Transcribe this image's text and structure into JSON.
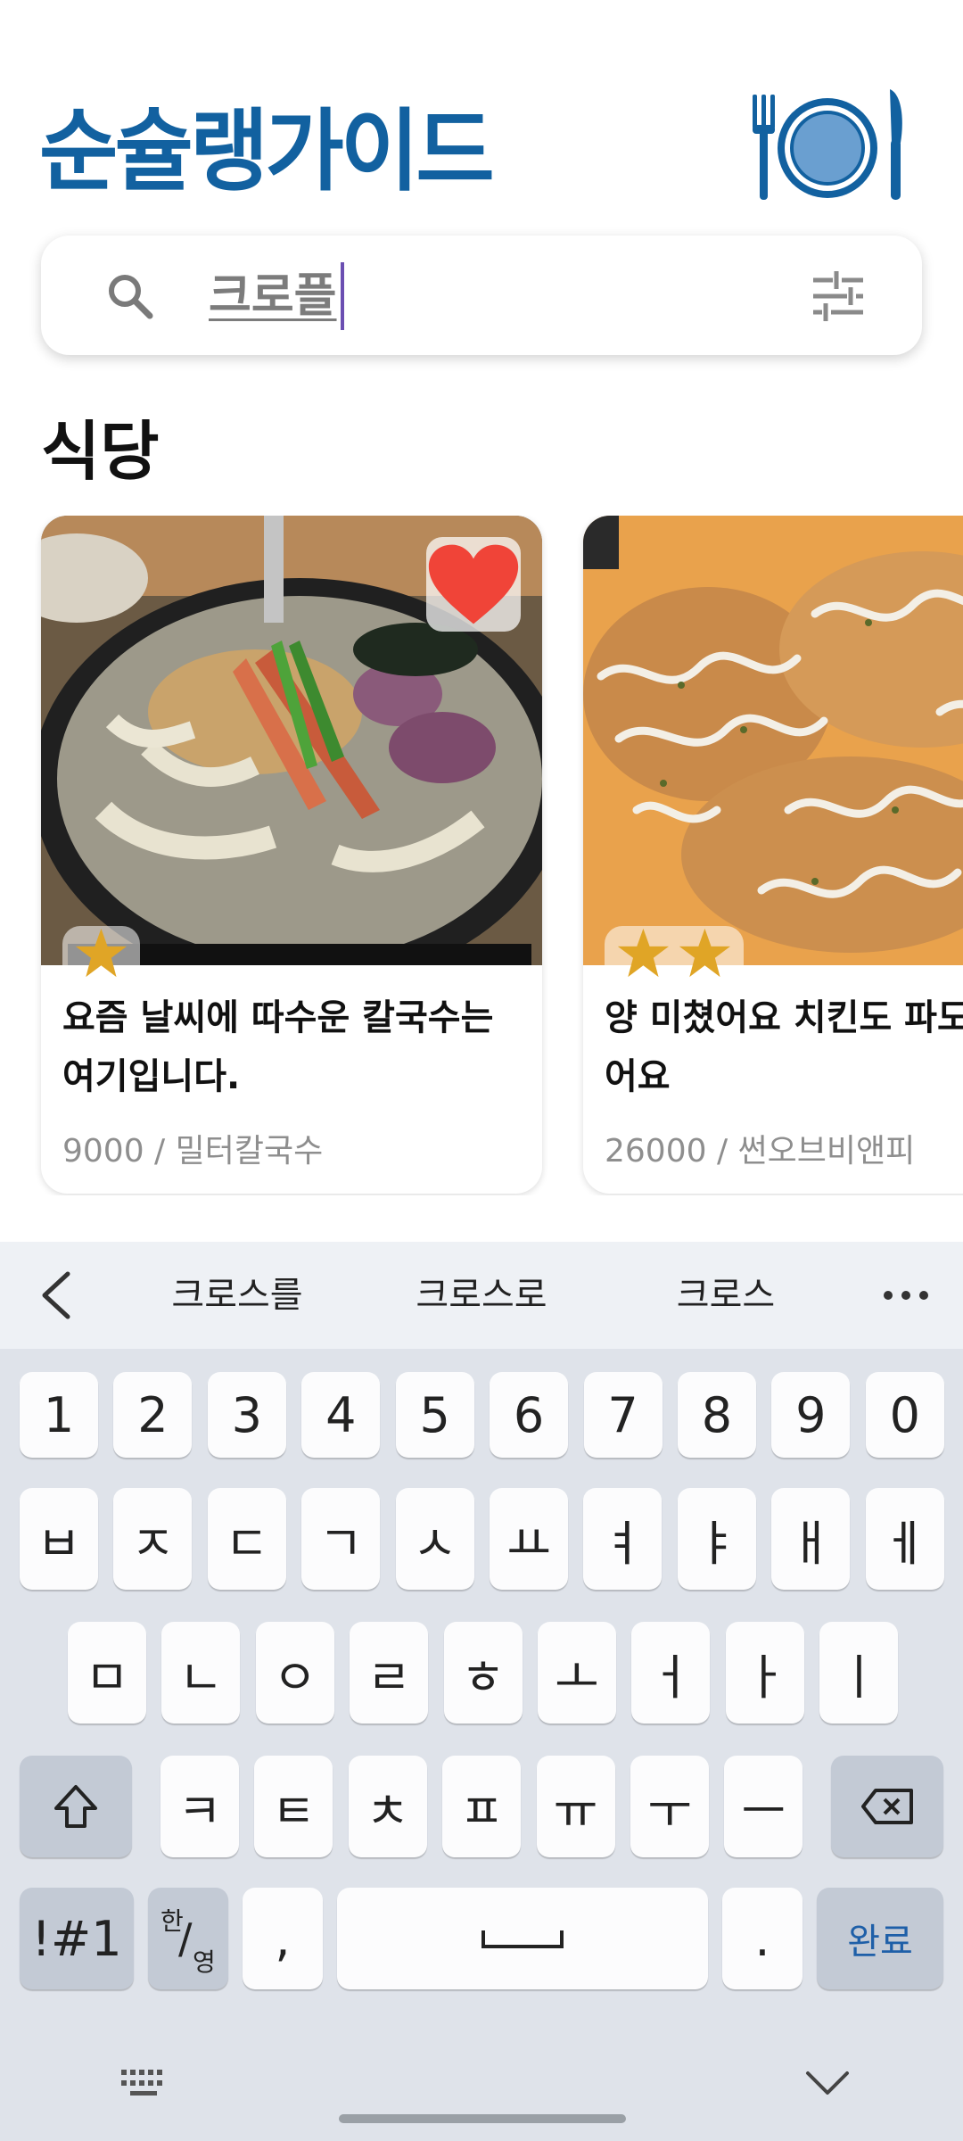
{
  "header": {
    "title": "순슐랭가이드",
    "logo_icon": "plate-fork-knife-icon",
    "brand_color": "#1261a0"
  },
  "search": {
    "value": "크로플",
    "search_icon": "search-icon",
    "filter_icon": "filter-sliders-icon"
  },
  "section": {
    "title": "식당"
  },
  "restaurants": [
    {
      "title": "요즘 날씨에 따수운 칼국수는 여기입니다.",
      "meta": "9000 / 밀터칼국수",
      "rating": 1,
      "favorited": true,
      "image": "seafood-kalguksu-photo"
    },
    {
      "title": "양 미쳤어요 치킨도 파도 미쳤어요",
      "meta": "26000 / 썬오브비앤피",
      "rating": 2,
      "favorited": false,
      "image": "cheese-chicken-photo"
    }
  ],
  "keyboard": {
    "suggestions": [
      "크로스를",
      "크로스로",
      "크로스"
    ],
    "number_row": [
      "1",
      "2",
      "3",
      "4",
      "5",
      "6",
      "7",
      "8",
      "9",
      "0"
    ],
    "row1": [
      "ㅂ",
      "ㅈ",
      "ㄷ",
      "ㄱ",
      "ㅅ",
      "ㅛ",
      "ㅕ",
      "ㅑ",
      "ㅐ",
      "ㅔ"
    ],
    "row2": [
      "ㅁ",
      "ㄴ",
      "ㅇ",
      "ㄹ",
      "ㅎ",
      "ㅗ",
      "ㅓ",
      "ㅏ",
      "ㅣ"
    ],
    "row3": [
      "ㅋ",
      "ㅌ",
      "ㅊ",
      "ㅍ",
      "ㅠ",
      "ㅜ",
      "ㅡ"
    ],
    "symbols_label": "!#1",
    "lang_top": "한",
    "lang_bottom": "영",
    "comma": ",",
    "period": ".",
    "done_label": "완료"
  },
  "colors": {
    "heart": "#f04438",
    "star": "#e0a526",
    "keyboard_bg": "#dfe3ea",
    "done_text": "#1e5fa8"
  }
}
